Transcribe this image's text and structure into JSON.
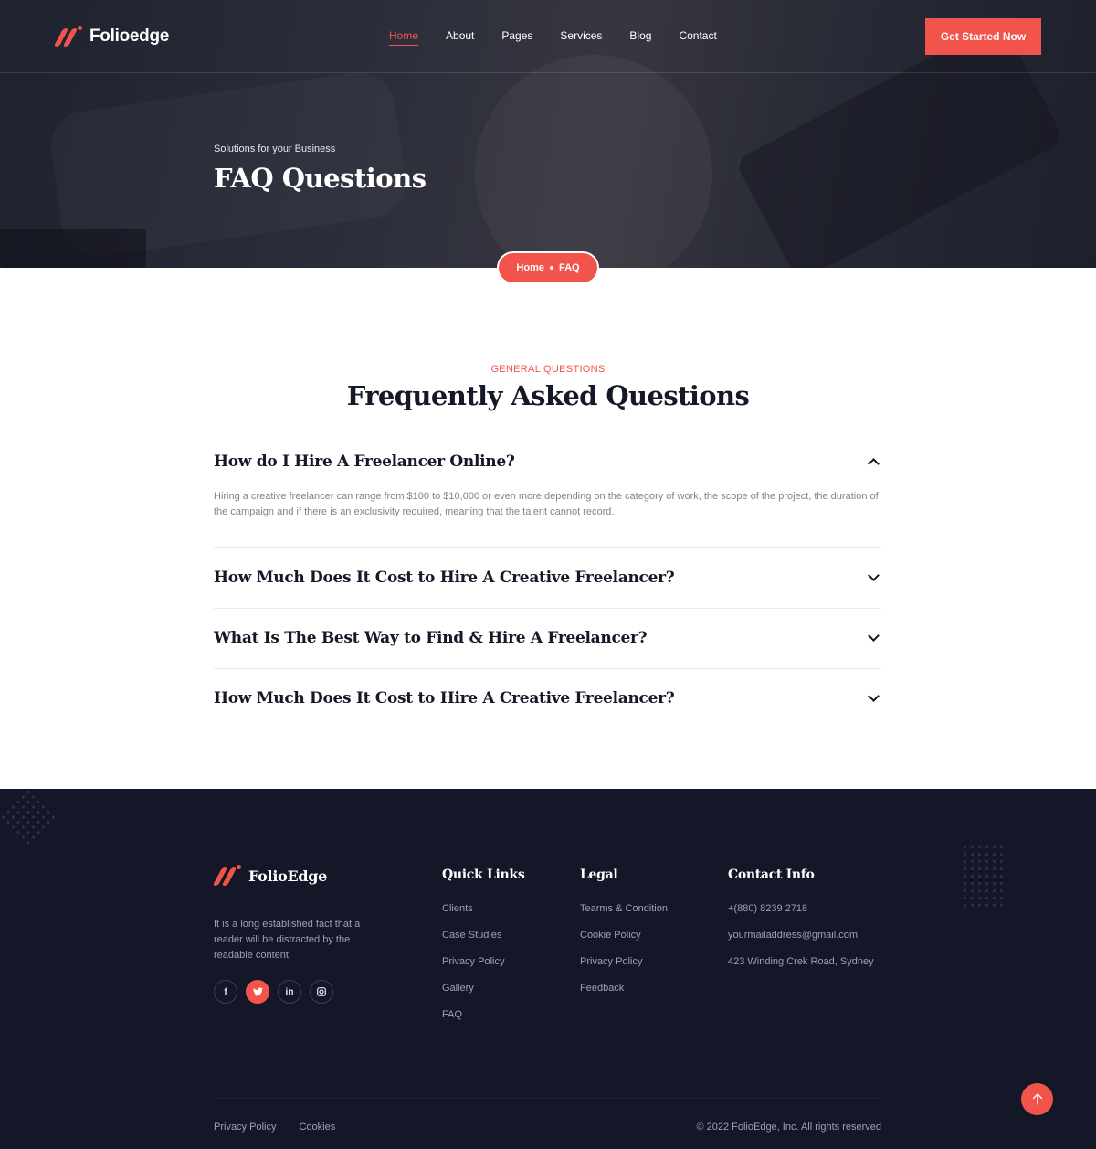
{
  "header": {
    "brand": "Folioedge",
    "nav": [
      {
        "label": "Home",
        "active": true
      },
      {
        "label": "About",
        "active": false
      },
      {
        "label": "Pages",
        "active": false
      },
      {
        "label": "Services",
        "active": false
      },
      {
        "label": "Blog",
        "active": false
      },
      {
        "label": "Contact",
        "active": false
      }
    ],
    "cta_label": "Get Started Now"
  },
  "hero": {
    "subtitle": "Solutions for your Business",
    "title": "FAQ Questions",
    "breadcrumb": [
      "Home",
      "FAQ"
    ]
  },
  "faq": {
    "eyebrow": "GENERAL QUESTIONS",
    "title": "Frequently Asked Questions",
    "items": [
      {
        "question": "How do I Hire A Freelancer Online?",
        "answer": "Hiring a creative freelancer can range from $100 to $10,000 or even more depending on the category of work, the scope of the project, the duration of the campaign and if there is an exclusivity required, meaning that the talent cannot record.",
        "expanded": true
      },
      {
        "question": "How Much Does It Cost to Hire A Creative Freelancer?",
        "expanded": false
      },
      {
        "question": "What Is The Best Way to Find & Hire A Freelancer?",
        "expanded": false
      },
      {
        "question": "How Much Does It Cost to Hire A Creative Freelancer?",
        "expanded": false
      }
    ]
  },
  "footer": {
    "brand": "FolioEdge",
    "about": "It is a long established fact that a reader will be distracted by the readable content.",
    "socials": [
      {
        "icon": "facebook-icon",
        "glyph": "f",
        "active": false
      },
      {
        "icon": "twitter-icon",
        "glyph": "t",
        "active": true
      },
      {
        "icon": "linkedin-icon",
        "glyph": "in",
        "active": false
      },
      {
        "icon": "instagram-icon",
        "glyph": "◙",
        "active": false
      }
    ],
    "quick_links": {
      "title": "Quick Links",
      "links": [
        "Clients",
        "Case Studies",
        "Privacy Policy",
        "Gallery",
        "FAQ"
      ]
    },
    "legal": {
      "title": "Legal",
      "links": [
        "Tearms & Condition",
        "Cookie Policy",
        "Privacy Policy",
        "Feedback"
      ]
    },
    "contact": {
      "title": "Contact Info",
      "lines": [
        "+(880) 8239 2718",
        "yourmailaddress@gmail.com",
        "423 Winding Crek Road, Sydney"
      ]
    },
    "bottom_links": [
      "Privacy Policy",
      "Cookies"
    ],
    "copyright": "© 2022 FolioEdge, Inc. All rights reserved"
  },
  "colors": {
    "accent": "#f2544b",
    "footer_bg": "#131727",
    "heading": "#151827"
  }
}
